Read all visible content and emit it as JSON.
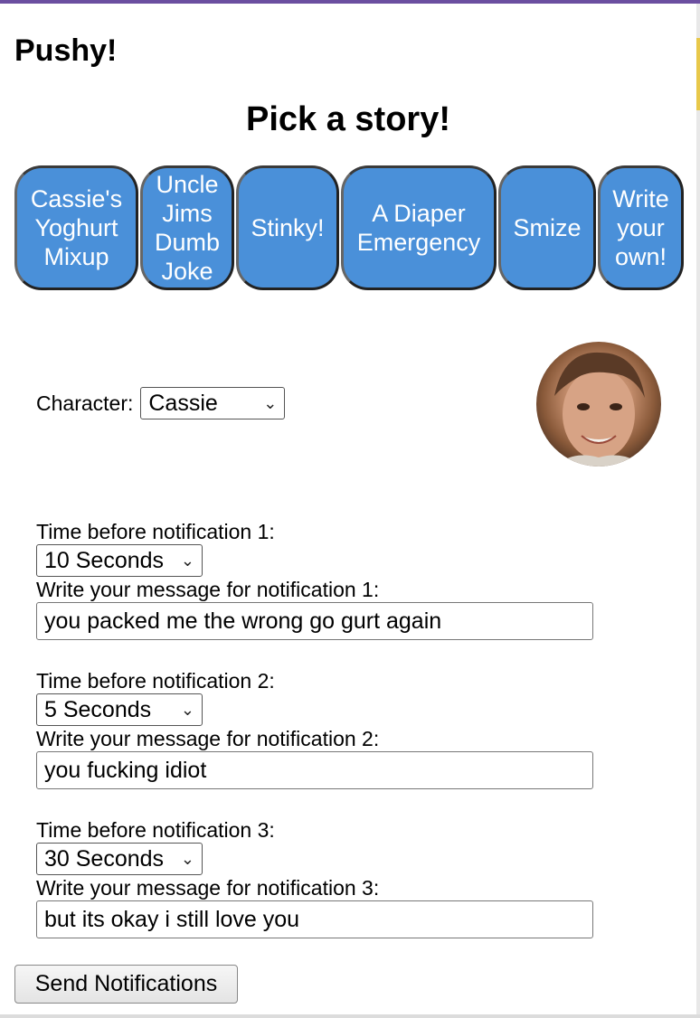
{
  "app": {
    "title": "Pushy!",
    "subtitle": "Pick a story!"
  },
  "stories": [
    {
      "label": "Cassie's\nYoghurt\nMixup"
    },
    {
      "label": "Uncle\nJims\nDumb\nJoke"
    },
    {
      "label": "Stinky!"
    },
    {
      "label": "A Diaper\nEmergency"
    },
    {
      "label": "Smize"
    },
    {
      "label": "Write\nyour\nown!"
    }
  ],
  "character": {
    "label": "Character:",
    "selected": "Cassie",
    "avatar_icon": "girl-avatar-photo"
  },
  "notifications": [
    {
      "time_label": "Time before notification 1:",
      "time_value": "10 Seconds",
      "message_label": "Write your message for notification 1:",
      "message_value": "you packed me the wrong go gurt again"
    },
    {
      "time_label": "Time before notification 2:",
      "time_value": "5 Seconds",
      "message_label": "Write your message for notification 2:",
      "message_value": "you fucking idiot"
    },
    {
      "time_label": "Time before notification 3:",
      "time_value": "30 Seconds",
      "message_label": "Write your message for notification 3:",
      "message_value": "but its okay i still love you"
    }
  ],
  "send_button": {
    "label": "Send Notifications"
  },
  "colors": {
    "story_button": "#4a90d9",
    "top_bar": "#6b4fa0"
  }
}
